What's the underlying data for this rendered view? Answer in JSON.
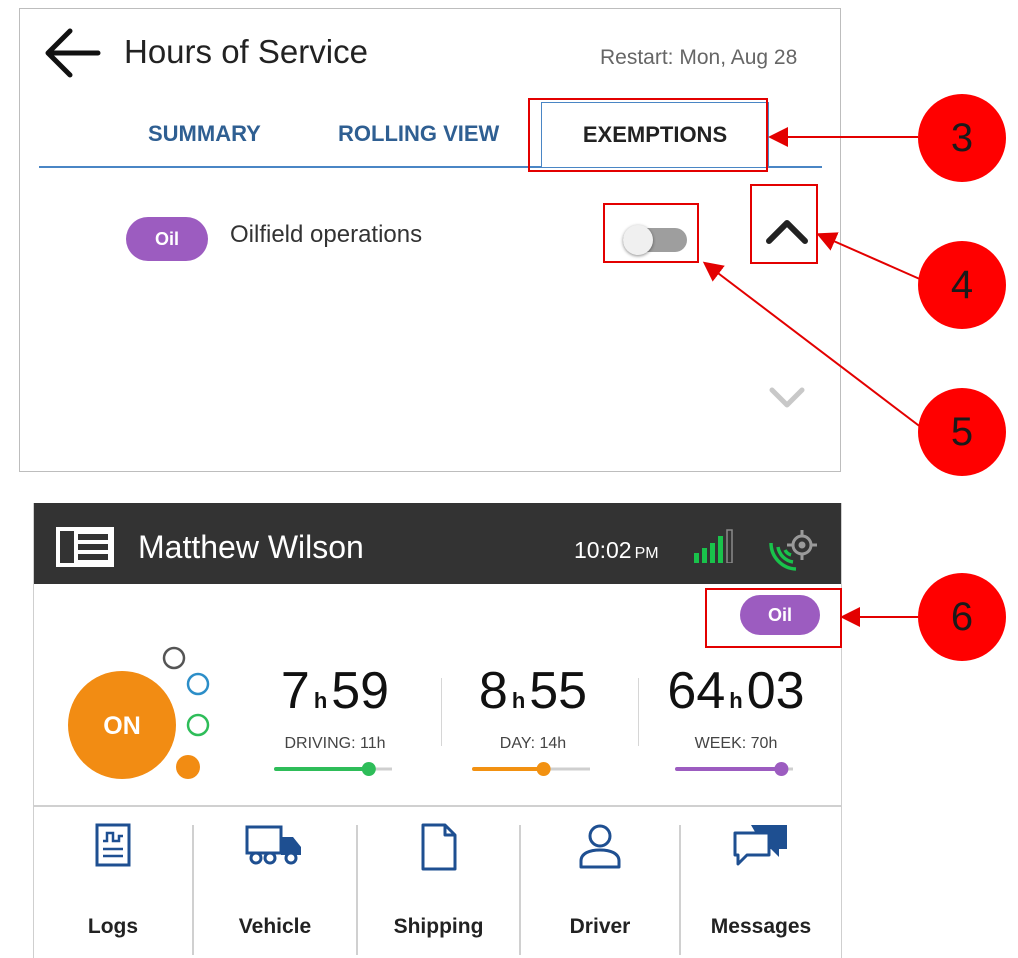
{
  "hos": {
    "title": "Hours of Service",
    "restart": "Restart: Mon, Aug 28",
    "tabs": [
      "SUMMARY",
      "ROLLING VIEW",
      "EXEMPTIONS"
    ],
    "active_tab": "EXEMPTIONS",
    "exemption": {
      "badge": "Oil",
      "label": "Oilfield operations",
      "enabled": false
    }
  },
  "driver": {
    "name": "Matthew Wilson",
    "time": "10:02",
    "ampm": "PM",
    "badge": "Oil",
    "status": "ON",
    "clocks": [
      {
        "hours": "7",
        "h": "h",
        "minutes": "59",
        "label": "DRIVING: 11h",
        "fraction": 0.8,
        "color": "#2ebd59"
      },
      {
        "hours": "8",
        "h": "h",
        "minutes": "55",
        "label": "DAY: 14h",
        "fraction": 0.6,
        "color": "#f29111"
      },
      {
        "hours": "64",
        "h": "h",
        "minutes": "03",
        "label": "WEEK: 70h",
        "fraction": 0.9,
        "color": "#9c5cc0"
      }
    ],
    "nav": [
      "Logs",
      "Vehicle",
      "Shipping",
      "Driver",
      "Messages"
    ]
  },
  "colors": {
    "accent_blue": "#2f5f92",
    "tab_underline": "#4a86c5",
    "oil_purple": "#9c5cc0",
    "status_orange": "#f28c13",
    "header_bg": "#333333",
    "annotation_red": "#ff0000"
  },
  "icons": [
    "back-arrow-icon",
    "chevron-up-icon",
    "chevron-down-icon",
    "menu-icon",
    "signal-icon",
    "gps-icon",
    "logs-icon",
    "truck-icon",
    "document-icon",
    "person-icon",
    "chat-icon"
  ],
  "annotations": [
    "3",
    "4",
    "5",
    "6"
  ]
}
